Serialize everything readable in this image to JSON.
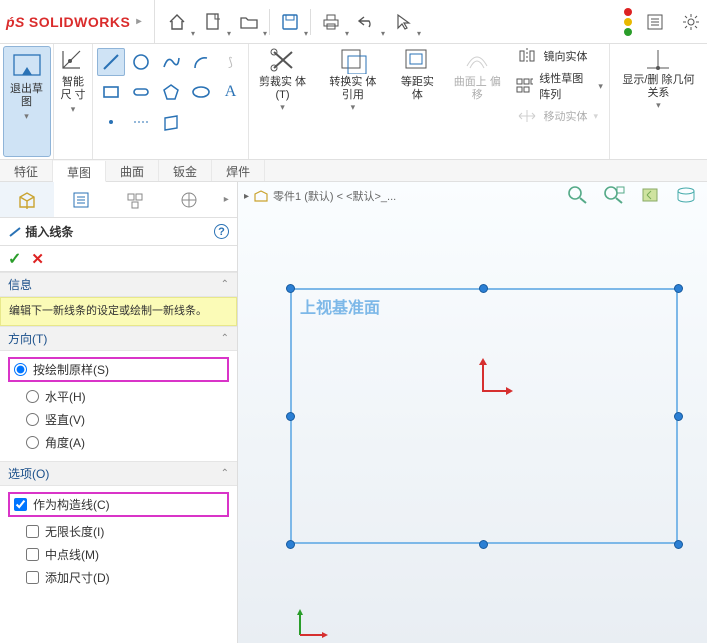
{
  "app": {
    "brand": "SOLIDWORKS"
  },
  "toolbar": {
    "home": "home",
    "new": "new",
    "open": "open",
    "save": "save",
    "print": "print",
    "undo": "undo",
    "arrow": "select",
    "rebuild": "rebuild",
    "options": "options",
    "settings": "settings"
  },
  "ribbon": {
    "exit_sketch": "退出草\n图",
    "smart_dim": "智能尺\n寸",
    "trim": "剪裁实\n体(T)",
    "convert": "转换实\n体引用",
    "offset": "等距实\n体",
    "oncurve": "曲面上\n偏移",
    "mirror": "镜向实体",
    "linear_pattern": "线性草图阵列",
    "move": "移动实体",
    "display": "显示/删\n除几何\n关系",
    "tabs": [
      "特征",
      "草图",
      "曲面",
      "钣金",
      "焊件"
    ],
    "active_tab": 1
  },
  "left": {
    "pm_title": "插入线条",
    "ok": "ok",
    "cancel": "cancel",
    "help": "?",
    "sec_info": "信息",
    "info_text": "编辑下一新线条的设定或绘制一新线条。",
    "sec_dir": "方向(T)",
    "dir_opts": {
      "as_sketched": "按绘制原样(S)",
      "horizontal": "水平(H)",
      "vertical": "竖直(V)",
      "angle": "角度(A)"
    },
    "dir_selected": "as_sketched",
    "sec_opt": "选项(O)",
    "opt_items": {
      "construction": "作为构造线(C)",
      "infinite": "无限长度(I)",
      "midpoint": "中点线(M)",
      "add_dim": "添加尺寸(D)"
    },
    "opt_checked": [
      "construction"
    ]
  },
  "canvas": {
    "breadcrumb_part": "零件1 (默认) < <默认>_...",
    "plane_label": "上视基准面"
  }
}
